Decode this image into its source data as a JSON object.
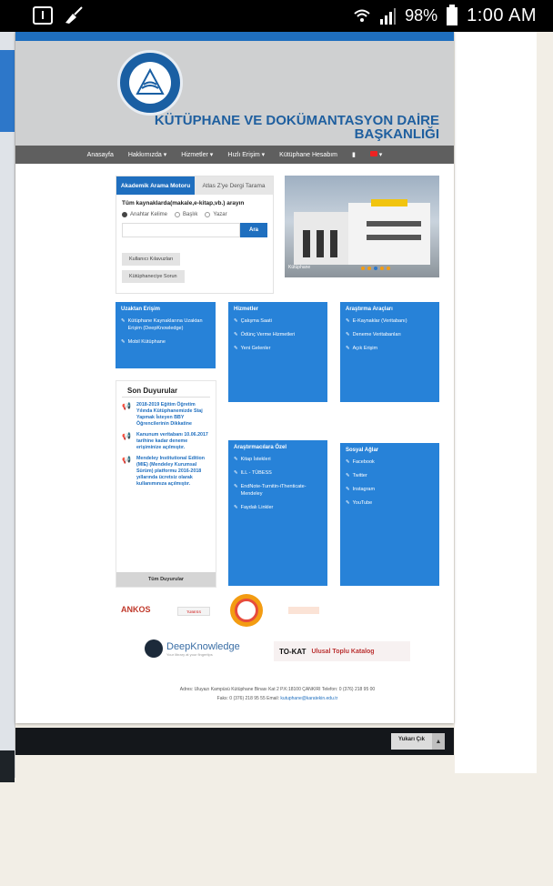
{
  "status_bar": {
    "battery": "98%",
    "time": "1:00 AM"
  },
  "site": {
    "title_line1": "KÜTÜPHANE VE DOKÜMANTASYON DAİRE",
    "title_line2": "BAŞKANLIĞI"
  },
  "nav": {
    "items": [
      "Anasayfa",
      "Hakkımızda ▾",
      "Hizmetler ▾",
      "Hızlı Erişim ▾",
      "Kütüphane Hesabım"
    ]
  },
  "search": {
    "tabs": [
      "Akademik Arama Motoru",
      "Atlas Z'ye Dergi Tarama"
    ],
    "heading": "Tüm kaynaklarda(makale,e-kitap,vb.) arayın",
    "radio_options": [
      "Anahtar Kelime",
      "Başlık",
      "Yazar"
    ],
    "search_button": "Ara",
    "guide_button": "Kullanıcı Kılavuzları",
    "ask_button": "Kütüphaneciye Sorun"
  },
  "slider": {
    "caption": "Kütüphane"
  },
  "remote_access": {
    "title": "Uzaktan Erişim",
    "items": [
      "Kütüphane Kaynaklarına Uzaktan Erişim (DeepKnowledge)",
      "Mobil Kütüphane"
    ]
  },
  "services": {
    "title": "Hizmetler",
    "items": [
      "Çalışma Saati",
      "Ödünç Verme Hizmetleri",
      "Yeni Gelenler"
    ]
  },
  "research_tools": {
    "title": "Araştırma Araçları",
    "items": [
      "E-Kaynaklar (Veritabanı)",
      "Deneme Veritabanları",
      "Açık Erişim"
    ]
  },
  "researchers": {
    "title": "Araştırmacılara Özel",
    "items": [
      "Kitap İstekleri",
      "ILL - TÜBESS",
      "EndNote-Turnitin-iThenticate-Mendeley",
      "Faydalı Linkler"
    ]
  },
  "social": {
    "title": "Sosyal Ağlar",
    "items": [
      "Facebook",
      "Twitter",
      "Instagram",
      "YouTube"
    ]
  },
  "announcements": {
    "title": "Son Duyurular",
    "items": [
      "2018-2019 Eğitim Öğretim Yılında Kütüphanemizde Staj Yapmak İsteyen BBY Öğrencilerinin Dikkatine",
      "Kanunum veritabanı 10.06.2017 tarihine kadar deneme erişiminize açılmıştır.",
      "Mendeley Institutional Edition (MIE) (Mendeley Kurumsal Sürüm) platformu 2016-2018 yıllarında ücretsiz olarak kullanımınıza açılmıştır."
    ],
    "all_button": "Tüm Duyurular"
  },
  "partners": {
    "ankos": "ANKOS",
    "tubess": "TÜBESS",
    "deepknowledge": "DeepKnowledge",
    "deepknowledge_sub": "Your library at your fingertips",
    "tokat": "TO-KAT",
    "tokat_rest": "Ulusal Toplu Katalog"
  },
  "footer": {
    "address": "Adres: Uluyazı Kampüsü Kütüphane Binası Kat 2 P.K:18100 ÇANKIRI   Telefon: 0 (376) 218 95 00",
    "fax_email_label": "Faks: 0 (376) 218 95 55   Email:",
    "email": "kutuphane@karatekin.edu.tr"
  },
  "back_to_top": "Yukarı Çık"
}
